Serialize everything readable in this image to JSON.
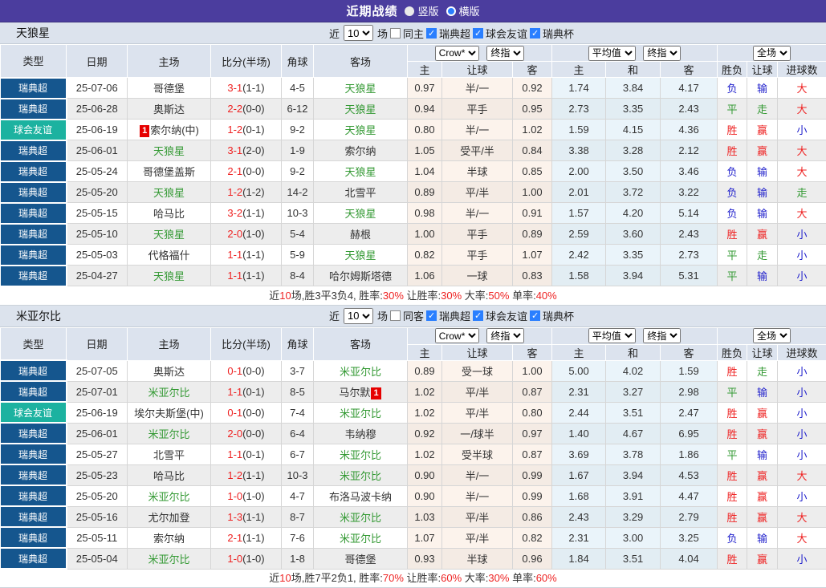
{
  "colors": {
    "topbar_purple": "#4B3D9E",
    "league_blue": "#15568E",
    "friendly_teal": "#1CB2A0",
    "win_red": "#EE2222",
    "draw_green": "#339933",
    "lose_blue": "#2222CC",
    "self_team_green": "#339933",
    "checkbox_blue": "#2A7FFF",
    "header_gray": "#DCE3EE"
  },
  "topbar": {
    "title": "近期战绩",
    "radio_vertical": "竖版",
    "radio_horizontal": "横版"
  },
  "labels": {
    "near": "近",
    "matches": "场"
  },
  "controls": {
    "count": "10",
    "leagues": [
      "瑞典超",
      "球会友谊",
      "瑞典杯"
    ]
  },
  "dropdowns": {
    "odds_source": "Crow*",
    "final": "终指",
    "average": "平均值",
    "fulltime": "全场"
  },
  "headers": {
    "type": "类型",
    "date": "日期",
    "home": "主场",
    "score": "比分(半场)",
    "corner": "角球",
    "away": "客场",
    "h": "主",
    "handicap": "让球",
    "a": "客",
    "draw": "和",
    "result": "胜负",
    "goals": "进球数"
  },
  "sections": [
    {
      "team": "天狼星",
      "same_label": "同主",
      "rows": [
        {
          "type": "瑞典超",
          "friendly": false,
          "date": "25-07-06",
          "home": "哥德堡",
          "home_self": false,
          "home_badge": "",
          "home_badge_pos": "",
          "score": "3-1",
          "half": "(1-1)",
          "corner": "4-5",
          "away": "天狼星",
          "away_self": true,
          "away_badge": "",
          "away_badge_pos": "",
          "odds": [
            "0.97",
            "半/一",
            "0.92"
          ],
          "avg": [
            "1.74",
            "3.84",
            "4.17"
          ],
          "result": [
            "负",
            "输",
            "大"
          ],
          "result_colors": [
            "b",
            "b",
            "r"
          ]
        },
        {
          "type": "瑞典超",
          "friendly": false,
          "date": "25-06-28",
          "home": "奥斯达",
          "home_self": false,
          "home_badge": "",
          "home_badge_pos": "",
          "score": "2-2",
          "half": "(0-0)",
          "corner": "6-12",
          "away": "天狼星",
          "away_self": true,
          "away_badge": "",
          "away_badge_pos": "",
          "odds": [
            "0.94",
            "平手",
            "0.95"
          ],
          "avg": [
            "2.73",
            "3.35",
            "2.43"
          ],
          "result": [
            "平",
            "走",
            "大"
          ],
          "result_colors": [
            "g",
            "g",
            "r"
          ]
        },
        {
          "type": "球会友谊",
          "friendly": true,
          "date": "25-06-19",
          "home": "索尔纳(中)",
          "home_self": false,
          "home_badge": "1",
          "home_badge_pos": "before",
          "score": "1-2",
          "half": "(0-1)",
          "corner": "9-2",
          "away": "天狼星",
          "away_self": true,
          "away_badge": "",
          "away_badge_pos": "",
          "odds": [
            "0.80",
            "半/一",
            "1.02"
          ],
          "avg": [
            "1.59",
            "4.15",
            "4.36"
          ],
          "result": [
            "胜",
            "赢",
            "小"
          ],
          "result_colors": [
            "r",
            "r",
            "b"
          ]
        },
        {
          "type": "瑞典超",
          "friendly": false,
          "date": "25-06-01",
          "home": "天狼星",
          "home_self": true,
          "home_badge": "",
          "home_badge_pos": "",
          "score": "3-1",
          "half": "(2-0)",
          "corner": "1-9",
          "away": "索尔纳",
          "away_self": false,
          "away_badge": "",
          "away_badge_pos": "",
          "odds": [
            "1.05",
            "受平/半",
            "0.84"
          ],
          "avg": [
            "3.38",
            "3.28",
            "2.12"
          ],
          "result": [
            "胜",
            "赢",
            "大"
          ],
          "result_colors": [
            "r",
            "r",
            "r"
          ]
        },
        {
          "type": "瑞典超",
          "friendly": false,
          "date": "25-05-24",
          "home": "哥德堡盖斯",
          "home_self": false,
          "home_badge": "",
          "home_badge_pos": "",
          "score": "2-1",
          "half": "(0-0)",
          "corner": "9-2",
          "away": "天狼星",
          "away_self": true,
          "away_badge": "",
          "away_badge_pos": "",
          "odds": [
            "1.04",
            "半球",
            "0.85"
          ],
          "avg": [
            "2.00",
            "3.50",
            "3.46"
          ],
          "result": [
            "负",
            "输",
            "大"
          ],
          "result_colors": [
            "b",
            "b",
            "r"
          ]
        },
        {
          "type": "瑞典超",
          "friendly": false,
          "date": "25-05-20",
          "home": "天狼星",
          "home_self": true,
          "home_badge": "",
          "home_badge_pos": "",
          "score": "1-2",
          "half": "(1-2)",
          "corner": "14-2",
          "away": "北雪平",
          "away_self": false,
          "away_badge": "",
          "away_badge_pos": "",
          "odds": [
            "0.89",
            "平/半",
            "1.00"
          ],
          "avg": [
            "2.01",
            "3.72",
            "3.22"
          ],
          "result": [
            "负",
            "输",
            "走"
          ],
          "result_colors": [
            "b",
            "b",
            "g"
          ]
        },
        {
          "type": "瑞典超",
          "friendly": false,
          "date": "25-05-15",
          "home": "哈马比",
          "home_self": false,
          "home_badge": "",
          "home_badge_pos": "",
          "score": "3-2",
          "half": "(1-1)",
          "corner": "10-3",
          "away": "天狼星",
          "away_self": true,
          "away_badge": "",
          "away_badge_pos": "",
          "odds": [
            "0.98",
            "半/一",
            "0.91"
          ],
          "avg": [
            "1.57",
            "4.20",
            "5.14"
          ],
          "result": [
            "负",
            "输",
            "大"
          ],
          "result_colors": [
            "b",
            "b",
            "r"
          ]
        },
        {
          "type": "瑞典超",
          "friendly": false,
          "date": "25-05-10",
          "home": "天狼星",
          "home_self": true,
          "home_badge": "",
          "home_badge_pos": "",
          "score": "2-0",
          "half": "(1-0)",
          "corner": "5-4",
          "away": "赫根",
          "away_self": false,
          "away_badge": "",
          "away_badge_pos": "",
          "odds": [
            "1.00",
            "平手",
            "0.89"
          ],
          "avg": [
            "2.59",
            "3.60",
            "2.43"
          ],
          "result": [
            "胜",
            "赢",
            "小"
          ],
          "result_colors": [
            "r",
            "r",
            "b"
          ]
        },
        {
          "type": "瑞典超",
          "friendly": false,
          "date": "25-05-03",
          "home": "代格福什",
          "home_self": false,
          "home_badge": "",
          "home_badge_pos": "",
          "score": "1-1",
          "half": "(1-1)",
          "corner": "5-9",
          "away": "天狼星",
          "away_self": true,
          "away_badge": "",
          "away_badge_pos": "",
          "odds": [
            "0.82",
            "平手",
            "1.07"
          ],
          "avg": [
            "2.42",
            "3.35",
            "2.73"
          ],
          "result": [
            "平",
            "走",
            "小"
          ],
          "result_colors": [
            "g",
            "g",
            "b"
          ]
        },
        {
          "type": "瑞典超",
          "friendly": false,
          "date": "25-04-27",
          "home": "天狼星",
          "home_self": true,
          "home_badge": "",
          "home_badge_pos": "",
          "score": "1-1",
          "half": "(1-1)",
          "corner": "8-4",
          "away": "哈尔姆斯塔德",
          "away_self": false,
          "away_badge": "",
          "away_badge_pos": "",
          "odds": [
            "1.06",
            "一球",
            "0.83"
          ],
          "avg": [
            "1.58",
            "3.94",
            "5.31"
          ],
          "result": [
            "平",
            "输",
            "小"
          ],
          "result_colors": [
            "g",
            "b",
            "b"
          ]
        }
      ],
      "summary": [
        [
          "近",
          0
        ],
        [
          "10",
          1
        ],
        [
          "场,胜3平3负4, 胜率:",
          0
        ],
        [
          "30%",
          1
        ],
        [
          " 让胜率:",
          0
        ],
        [
          "30%",
          1
        ],
        [
          " 大率:",
          0
        ],
        [
          "50%",
          1
        ],
        [
          " 单率:",
          0
        ],
        [
          "40%",
          1
        ]
      ]
    },
    {
      "team": "米亚尔比",
      "same_label": "同客",
      "rows": [
        {
          "type": "瑞典超",
          "friendly": false,
          "date": "25-07-05",
          "home": "奥斯达",
          "home_self": false,
          "home_badge": "",
          "home_badge_pos": "",
          "score": "0-1",
          "half": "(0-0)",
          "corner": "3-7",
          "away": "米亚尔比",
          "away_self": true,
          "away_badge": "",
          "away_badge_pos": "",
          "odds": [
            "0.89",
            "受一球",
            "1.00"
          ],
          "avg": [
            "5.00",
            "4.02",
            "1.59"
          ],
          "result": [
            "胜",
            "走",
            "小"
          ],
          "result_colors": [
            "r",
            "g",
            "b"
          ]
        },
        {
          "type": "瑞典超",
          "friendly": false,
          "date": "25-07-01",
          "home": "米亚尔比",
          "home_self": true,
          "home_badge": "",
          "home_badge_pos": "",
          "score": "1-1",
          "half": "(0-1)",
          "corner": "8-5",
          "away": "马尔默",
          "away_self": false,
          "away_badge": "1",
          "away_badge_pos": "after",
          "odds": [
            "1.02",
            "平/半",
            "0.87"
          ],
          "avg": [
            "2.31",
            "3.27",
            "2.98"
          ],
          "result": [
            "平",
            "输",
            "小"
          ],
          "result_colors": [
            "g",
            "b",
            "b"
          ]
        },
        {
          "type": "球会友谊",
          "friendly": true,
          "date": "25-06-19",
          "home": "埃尔夫斯堡(中)",
          "home_self": false,
          "home_badge": "",
          "home_badge_pos": "",
          "score": "0-1",
          "half": "(0-0)",
          "corner": "7-4",
          "away": "米亚尔比",
          "away_self": true,
          "away_badge": "",
          "away_badge_pos": "",
          "odds": [
            "1.02",
            "平/半",
            "0.80"
          ],
          "avg": [
            "2.44",
            "3.51",
            "2.47"
          ],
          "result": [
            "胜",
            "赢",
            "小"
          ],
          "result_colors": [
            "r",
            "r",
            "b"
          ]
        },
        {
          "type": "瑞典超",
          "friendly": false,
          "date": "25-06-01",
          "home": "米亚尔比",
          "home_self": true,
          "home_badge": "",
          "home_badge_pos": "",
          "score": "2-0",
          "half": "(0-0)",
          "corner": "6-4",
          "away": "韦纳穆",
          "away_self": false,
          "away_badge": "",
          "away_badge_pos": "",
          "odds": [
            "0.92",
            "一/球半",
            "0.97"
          ],
          "avg": [
            "1.40",
            "4.67",
            "6.95"
          ],
          "result": [
            "胜",
            "赢",
            "小"
          ],
          "result_colors": [
            "r",
            "r",
            "b"
          ]
        },
        {
          "type": "瑞典超",
          "friendly": false,
          "date": "25-05-27",
          "home": "北雪平",
          "home_self": false,
          "home_badge": "",
          "home_badge_pos": "",
          "score": "1-1",
          "half": "(0-1)",
          "corner": "6-7",
          "away": "米亚尔比",
          "away_self": true,
          "away_badge": "",
          "away_badge_pos": "",
          "odds": [
            "1.02",
            "受半球",
            "0.87"
          ],
          "avg": [
            "3.69",
            "3.78",
            "1.86"
          ],
          "result": [
            "平",
            "输",
            "小"
          ],
          "result_colors": [
            "g",
            "b",
            "b"
          ]
        },
        {
          "type": "瑞典超",
          "friendly": false,
          "date": "25-05-23",
          "home": "哈马比",
          "home_self": false,
          "home_badge": "",
          "home_badge_pos": "",
          "score": "1-2",
          "half": "(1-1)",
          "corner": "10-3",
          "away": "米亚尔比",
          "away_self": true,
          "away_badge": "",
          "away_badge_pos": "",
          "odds": [
            "0.90",
            "半/一",
            "0.99"
          ],
          "avg": [
            "1.67",
            "3.94",
            "4.53"
          ],
          "result": [
            "胜",
            "赢",
            "大"
          ],
          "result_colors": [
            "r",
            "r",
            "r"
          ]
        },
        {
          "type": "瑞典超",
          "friendly": false,
          "date": "25-05-20",
          "home": "米亚尔比",
          "home_self": true,
          "home_badge": "",
          "home_badge_pos": "",
          "score": "1-0",
          "half": "(1-0)",
          "corner": "4-7",
          "away": "布洛马波卡纳",
          "away_self": false,
          "away_badge": "",
          "away_badge_pos": "",
          "odds": [
            "0.90",
            "半/一",
            "0.99"
          ],
          "avg": [
            "1.68",
            "3.91",
            "4.47"
          ],
          "result": [
            "胜",
            "赢",
            "小"
          ],
          "result_colors": [
            "r",
            "r",
            "b"
          ]
        },
        {
          "type": "瑞典超",
          "friendly": false,
          "date": "25-05-16",
          "home": "尤尔加登",
          "home_self": false,
          "home_badge": "",
          "home_badge_pos": "",
          "score": "1-3",
          "half": "(1-1)",
          "corner": "8-7",
          "away": "米亚尔比",
          "away_self": true,
          "away_badge": "",
          "away_badge_pos": "",
          "odds": [
            "1.03",
            "平/半",
            "0.86"
          ],
          "avg": [
            "2.43",
            "3.29",
            "2.79"
          ],
          "result": [
            "胜",
            "赢",
            "大"
          ],
          "result_colors": [
            "r",
            "r",
            "r"
          ]
        },
        {
          "type": "瑞典超",
          "friendly": false,
          "date": "25-05-11",
          "home": "索尔纳",
          "home_self": false,
          "home_badge": "",
          "home_badge_pos": "",
          "score": "2-1",
          "half": "(1-1)",
          "corner": "7-6",
          "away": "米亚尔比",
          "away_self": true,
          "away_badge": "",
          "away_badge_pos": "",
          "odds": [
            "1.07",
            "平/半",
            "0.82"
          ],
          "avg": [
            "2.31",
            "3.00",
            "3.25"
          ],
          "result": [
            "负",
            "输",
            "大"
          ],
          "result_colors": [
            "b",
            "b",
            "r"
          ]
        },
        {
          "type": "瑞典超",
          "friendly": false,
          "date": "25-05-04",
          "home": "米亚尔比",
          "home_self": true,
          "home_badge": "",
          "home_badge_pos": "",
          "score": "1-0",
          "half": "(1-0)",
          "corner": "1-8",
          "away": "哥德堡",
          "away_self": false,
          "away_badge": "",
          "away_badge_pos": "",
          "odds": [
            "0.93",
            "半球",
            "0.96"
          ],
          "avg": [
            "1.84",
            "3.51",
            "4.04"
          ],
          "result": [
            "胜",
            "赢",
            "小"
          ],
          "result_colors": [
            "r",
            "r",
            "b"
          ]
        }
      ],
      "summary": [
        [
          "近",
          0
        ],
        [
          "10",
          1
        ],
        [
          "场,胜7平2负1, 胜率:",
          0
        ],
        [
          "70%",
          1
        ],
        [
          " 让胜率:",
          0
        ],
        [
          "60%",
          1
        ],
        [
          " 大率:",
          0
        ],
        [
          "30%",
          1
        ],
        [
          " 单率:",
          0
        ],
        [
          "60%",
          1
        ]
      ]
    }
  ]
}
